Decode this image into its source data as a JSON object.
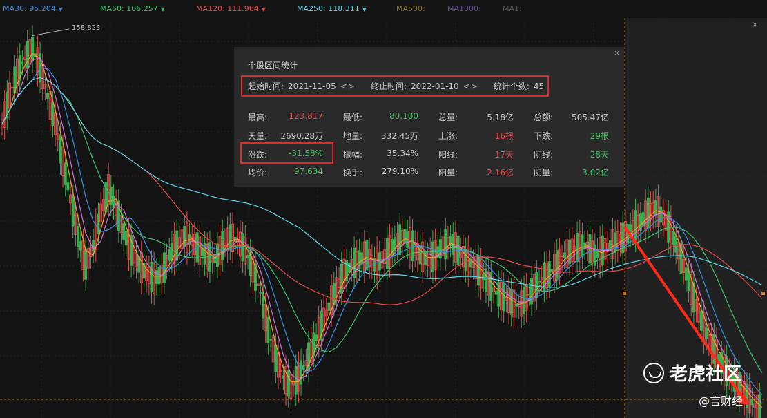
{
  "ma_bar": [
    {
      "label": "MA30: 95.204",
      "color": "#3a8ee6",
      "arrow": "▼"
    },
    {
      "label": "MA60: 106.257",
      "color": "#3fc26b",
      "arrow": "▼"
    },
    {
      "label": "MA120: 111.964",
      "color": "#e64c4c",
      "arrow": "▼"
    },
    {
      "label": "MA250: 118.311",
      "color": "#5fd3e8",
      "arrow": "▼"
    },
    {
      "label": "MA500:",
      "color": "#8c7a2a",
      "arrow": ""
    },
    {
      "label": "MA1000:",
      "color": "#6a4c9c",
      "arrow": ""
    },
    {
      "label": "MA1:",
      "color": "#555555",
      "arrow": ""
    }
  ],
  "peak_label": "158.823",
  "stats_panel": {
    "title": "个股区间统计",
    "close": "×",
    "start_label": "起始时间:",
    "start_value": "2021-11-05",
    "end_label": "终止时间:",
    "end_value": "2022-01-10",
    "count_label": "统计个数:",
    "count_value": "45",
    "arrows": "<>",
    "rows": [
      [
        {
          "label": "最高:",
          "value": "123.817",
          "color": "#e84b4b"
        },
        {
          "label": "最低:",
          "value": "80.100",
          "color": "#3fbf5f"
        },
        {
          "label": "总量:",
          "value": "5.18亿",
          "color": "#c8c8c8"
        },
        {
          "label": "总额:",
          "value": "505.47亿",
          "color": "#c8c8c8"
        }
      ],
      [
        {
          "label": "天量:",
          "value": "2690.28万",
          "color": "#c8c8c8"
        },
        {
          "label": "地量:",
          "value": "332.45万",
          "color": "#c8c8c8"
        },
        {
          "label": "上涨:",
          "value": "16根",
          "color": "#e84b4b"
        },
        {
          "label": "下跌:",
          "value": "29根",
          "color": "#3fbf5f"
        }
      ],
      [
        {
          "label": "涨跌:",
          "value": "-31.58%",
          "color": "#3fbf5f"
        },
        {
          "label": "振幅:",
          "value": "35.34%",
          "color": "#c8c8c8"
        },
        {
          "label": "阳线:",
          "value": "17天",
          "color": "#e84b4b"
        },
        {
          "label": "阴线:",
          "value": "28天",
          "color": "#3fbf5f"
        }
      ],
      [
        {
          "label": "均价:",
          "value": "97.634",
          "color": "#3fbf5f"
        },
        {
          "label": "换手:",
          "value": "279.10%",
          "color": "#c8c8c8"
        },
        {
          "label": "阳量:",
          "value": "2.16亿",
          "color": "#e84b4b"
        },
        {
          "label": "阴量:",
          "value": "3.02亿",
          "color": "#3fbf5f"
        }
      ]
    ]
  },
  "chart_close": "×",
  "watermark": "老虎社区",
  "credit": "@言财经",
  "chart_data": {
    "type": "candlestick",
    "price_axis_range": [
      78,
      162
    ],
    "peak_value": 158.823,
    "selected_range": {
      "start": "2021-11-05",
      "end": "2022-01-10",
      "bars": 45
    },
    "moving_averages": [
      {
        "name": "MA30",
        "last": 95.204,
        "color": "#3a8ee6"
      },
      {
        "name": "MA60",
        "last": 106.257,
        "color": "#3fc26b"
      },
      {
        "name": "MA120",
        "last": 111.964,
        "color": "#e64c4c"
      },
      {
        "name": "MA250",
        "last": 118.311,
        "color": "#5fd3e8"
      }
    ],
    "close_series": [
      140,
      146,
      151,
      154,
      156,
      152,
      146,
      140,
      132,
      124,
      116,
      110,
      114,
      121,
      126,
      122,
      117,
      113,
      110,
      108,
      107,
      108,
      112,
      114,
      116,
      115,
      113,
      112,
      111,
      114,
      116,
      115,
      113,
      109,
      104,
      96,
      90,
      86,
      84,
      86,
      89,
      93,
      97,
      101,
      105,
      108,
      110,
      111,
      112,
      110,
      111,
      113,
      115,
      116,
      114,
      112,
      111,
      112,
      114,
      115,
      113,
      111,
      110,
      108,
      106,
      104,
      103,
      102,
      101,
      103,
      105,
      107,
      108,
      110,
      112,
      113,
      114,
      114,
      112,
      113,
      114,
      115,
      116,
      118,
      119,
      121,
      122,
      120,
      117,
      113,
      108,
      103,
      98,
      94,
      91,
      88,
      86,
      84,
      82,
      80,
      79
    ],
    "trend_arrow": {
      "from_close": 118,
      "to_close": 80
    }
  }
}
